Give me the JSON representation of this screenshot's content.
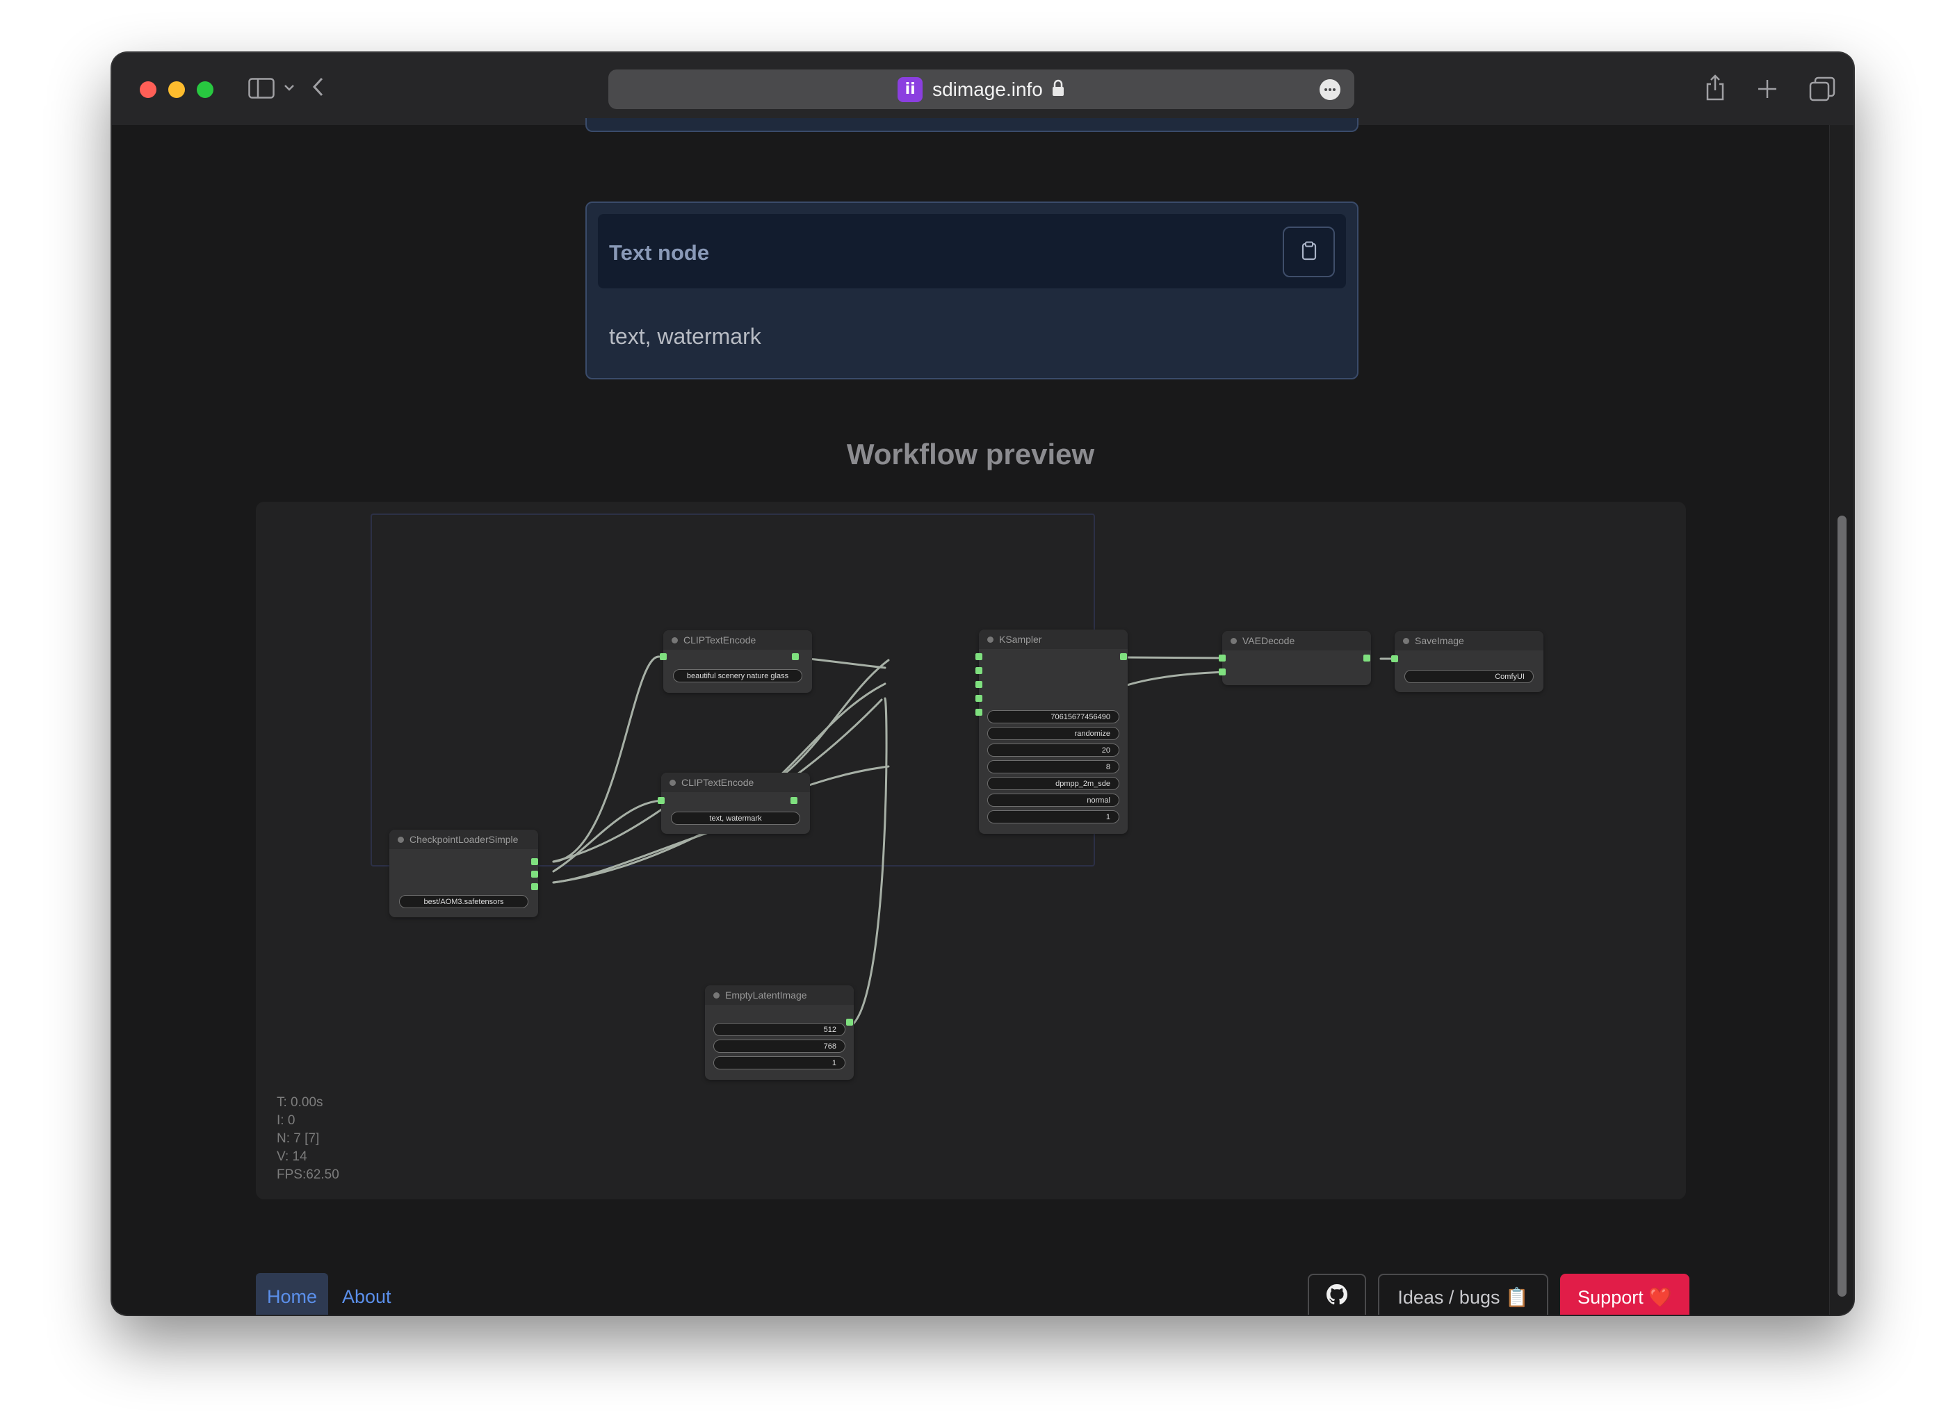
{
  "browser": {
    "url": "sdimage.info",
    "favicon_glyph": "ii",
    "icons": [
      "sidebar-icon",
      "chevron-down-icon",
      "back-icon",
      "lock-icon",
      "more-icon",
      "share-icon",
      "plus-icon",
      "tabs-icon"
    ]
  },
  "card": {
    "title": "Text node",
    "body": "text, watermark",
    "copy_icon": "clipboard-icon"
  },
  "section_title": "Workflow preview",
  "workflow": {
    "nodes": {
      "clip1": {
        "title": "CLIPTextEncode",
        "widget": "beautiful scenery nature glass"
      },
      "clip2": {
        "title": "CLIPTextEncode",
        "widget": "text, watermark"
      },
      "ksampler": {
        "title": "KSampler",
        "widgets": [
          "706156774564​90",
          "randomize",
          "20",
          "8",
          "dpmpp_2m_sde",
          "normal",
          "1"
        ]
      },
      "vae": {
        "title": "VAEDecode"
      },
      "save": {
        "title": "SaveImage",
        "widget": "ComfyUI"
      },
      "ckpt": {
        "title": "CheckpointLoaderSimple",
        "widget": "best/AOM3.safetensors"
      },
      "latent": {
        "title": "EmptyLatentImage",
        "widgets": [
          "512",
          "768",
          "1"
        ]
      }
    },
    "stats": [
      "T: 0.00s",
      "I: 0",
      "N: 7 [7]",
      "V: 14",
      "FPS:62.50"
    ]
  },
  "footer": {
    "home": "Home",
    "about": "About",
    "github_icon": "github-icon",
    "ideas": "Ideas / bugs 📋",
    "support": "Support ❤️"
  },
  "colors": {
    "accent_link": "#5b8fea",
    "support_button": "#e11d48",
    "card_bg": "#1f2a3d",
    "port": "#7fe07f"
  }
}
